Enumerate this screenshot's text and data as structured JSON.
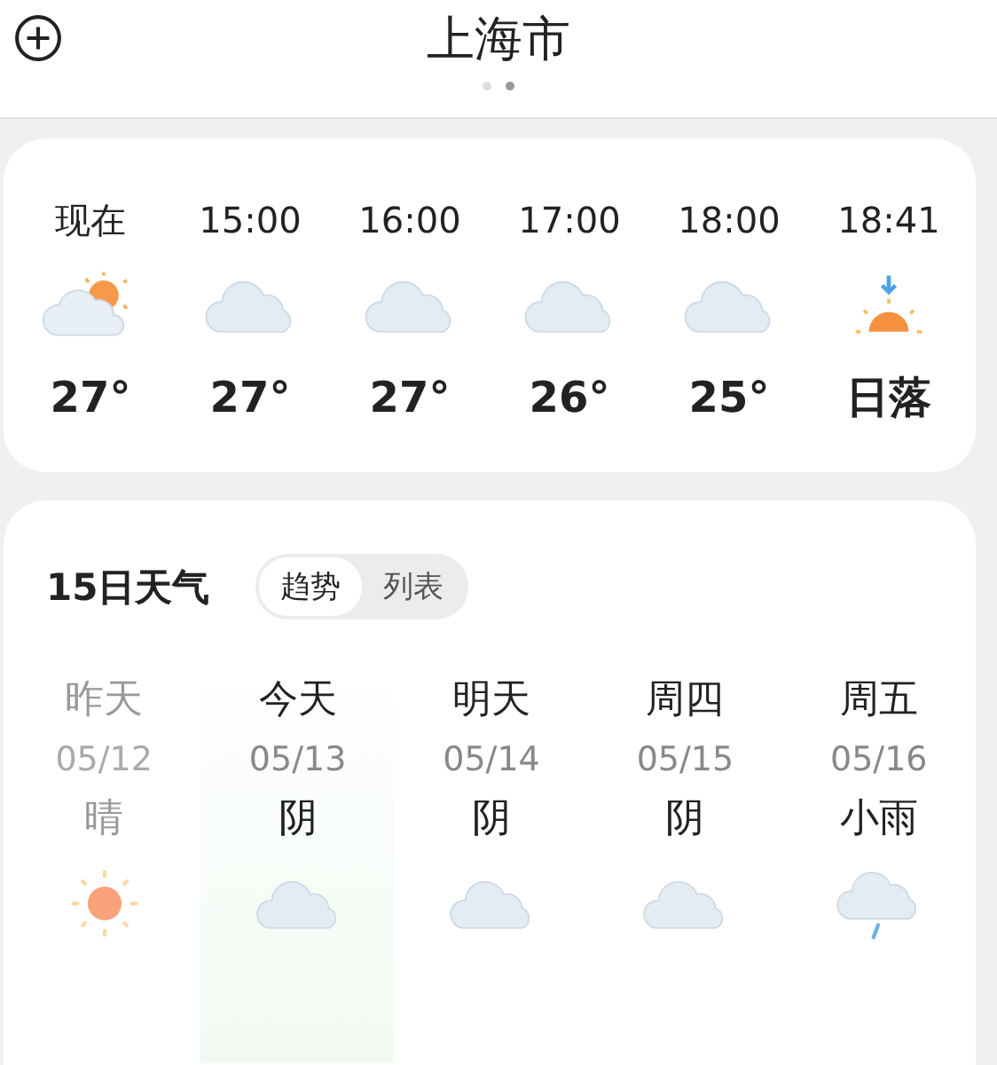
{
  "header": {
    "city": "上海市",
    "pages": [
      {
        "selected": false
      },
      {
        "selected": true
      }
    ]
  },
  "hourly": [
    {
      "time": "现在",
      "kind": "sun-cloud",
      "temp": "27°"
    },
    {
      "time": "15:00",
      "kind": "cloud",
      "temp": "27°"
    },
    {
      "time": "16:00",
      "kind": "cloud",
      "temp": "27°"
    },
    {
      "time": "17:00",
      "kind": "cloud",
      "temp": "26°"
    },
    {
      "time": "18:00",
      "kind": "cloud",
      "temp": "25°"
    },
    {
      "time": "18:41",
      "kind": "sunset",
      "temp": "日落"
    }
  ],
  "forecast": {
    "title": "15日天气",
    "views": [
      {
        "label": "趋势",
        "selected": true
      },
      {
        "label": "列表",
        "selected": false
      }
    ],
    "days": [
      {
        "day": "昨天",
        "date": "05/12",
        "condition": "晴",
        "kind": "sun",
        "past": true,
        "selected": false
      },
      {
        "day": "今天",
        "date": "05/13",
        "condition": "阴",
        "kind": "cloud",
        "past": false,
        "selected": true
      },
      {
        "day": "明天",
        "date": "05/14",
        "condition": "阴",
        "kind": "cloud",
        "past": false,
        "selected": false
      },
      {
        "day": "周四",
        "date": "05/15",
        "condition": "阴",
        "kind": "cloud",
        "past": false,
        "selected": false
      },
      {
        "day": "周五",
        "date": "05/16",
        "condition": "小雨",
        "kind": "rain",
        "past": false,
        "selected": false
      }
    ]
  }
}
